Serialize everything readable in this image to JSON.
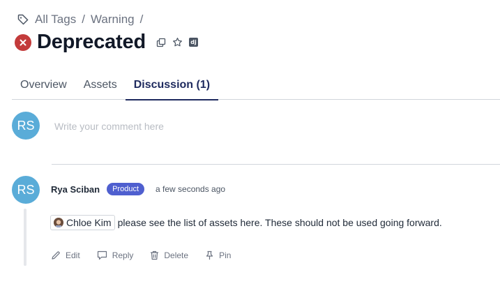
{
  "breadcrumb": {
    "items": [
      "All Tags",
      "Warning"
    ],
    "separator": "/"
  },
  "page": {
    "title": "Deprecated",
    "status_color": "#c33b3b",
    "badge_label": "dj"
  },
  "tabs": [
    {
      "label": "Overview",
      "active": false
    },
    {
      "label": "Assets",
      "active": false
    },
    {
      "label": "Discussion (1)",
      "active": true
    }
  ],
  "new_comment": {
    "avatar_initials": "RS",
    "placeholder": "Write your comment here"
  },
  "comments": [
    {
      "avatar_initials": "RS",
      "author": "Rya Sciban",
      "role": "Product",
      "timestamp": "a few seconds ago",
      "mention": "Chloe Kim",
      "text": "please see the list of assets here. These should not be used going forward.",
      "actions": [
        "Edit",
        "Reply",
        "Delete",
        "Pin"
      ]
    }
  ],
  "colors": {
    "accent": "#1e2a5e",
    "avatar": "#5aacd8",
    "role_badge": "#4f5fcf"
  }
}
